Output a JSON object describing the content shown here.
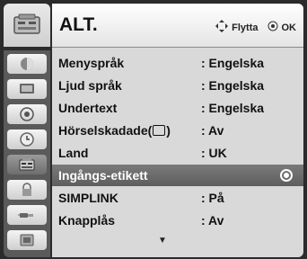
{
  "header": {
    "title": "ALT.",
    "move_hint": "Flytta",
    "ok_hint": "OK"
  },
  "menu": {
    "items": [
      {
        "label": "Menyspråk",
        "value": ": Engelska"
      },
      {
        "label": "Ljud språk",
        "value": ": Engelska"
      },
      {
        "label": "Undertext",
        "value": ": Engelska"
      },
      {
        "label": "Hörselskadade(",
        "label_suffix": ")",
        "value": ": Av"
      },
      {
        "label": "Land",
        "value": ": UK"
      },
      {
        "label": "Ingångs-etikett",
        "value": ""
      },
      {
        "label": "SIMPLINK",
        "value": ": På"
      },
      {
        "label": "Knapplås",
        "value": ": Av"
      }
    ],
    "selected_index": 5
  },
  "sidebar": {
    "icons": [
      "picture-icon",
      "tv-icon",
      "audio-icon",
      "clock-icon",
      "option-icon",
      "lock-icon",
      "input-icon",
      "usb-icon"
    ],
    "active_index": 4
  },
  "icons": {
    "move": "four-way-arrow-icon",
    "ok": "ok-button-icon",
    "more": "scroll-down-arrow-icon",
    "selected": "radio-selected-icon"
  },
  "colors": {
    "header_bg": "#f2f2f2",
    "panel_bg": "#d9d9d9",
    "selected_row": "#6a6a6a",
    "sidebar_bg": "#5a5a5a"
  }
}
